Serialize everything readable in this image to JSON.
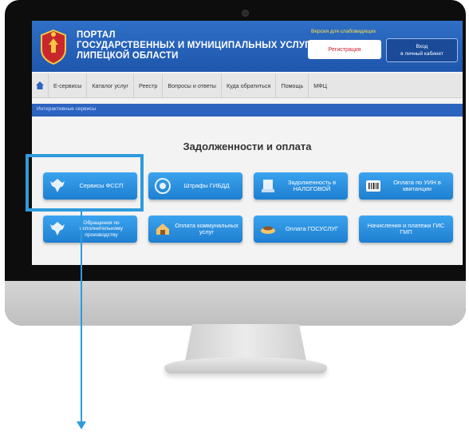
{
  "colors": {
    "header_blue": "#2f6fc6",
    "subbar_blue": "#2c64c0",
    "button_blue": "#3ba3ef",
    "highlight": "#2e9bdd",
    "register_text": "#d0202a",
    "visually_impaired_text": "#f8e04e"
  },
  "header": {
    "title_lines": [
      "ПОРТАЛ",
      "ГОСУДАРСТВЕННЫХ И МУНИЦИПАЛЬНЫХ УСЛУГ",
      "ЛИПЕЦКОЙ ОБЛАСТИ"
    ],
    "visually_impaired": "Версия для слабовидящих",
    "register_label": "Регистрация",
    "login_label_1": "Вход",
    "login_label_2": "в личный кабинет",
    "emblem_icon": "lipetsk-coat-of-arms-icon"
  },
  "nav": {
    "home_icon": "home-icon",
    "items": [
      "Е-сервисы",
      "Каталог услуг",
      "Реестр",
      "Вопросы и ответы",
      "Куда обратиться",
      "Помощь",
      "МФЦ"
    ]
  },
  "subbar": {
    "label": "Интерактивные сервисы"
  },
  "section": {
    "title": "Задолженности и оплата"
  },
  "services": [
    {
      "label": "Сервисы ФССП",
      "icon": "fssp-emblem-icon"
    },
    {
      "label": "Штрафы ГИБДД",
      "icon": "gibdd-badge-icon"
    },
    {
      "label": "Задолженность в НАЛОГОВОЙ",
      "icon": "tax-document-icon"
    },
    {
      "label": "Оплата по УИН в квитанции",
      "icon": "barcode-icon"
    },
    {
      "label": "Обращения по исполнительному производству",
      "icon": "fssp-emblem-icon"
    },
    {
      "label": "Оплата коммунальных услуг",
      "icon": "utilities-house-icon"
    },
    {
      "label": "Оплата ГОСУСЛУГ",
      "icon": "gosuslugi-payment-icon"
    },
    {
      "label": "Начисления и платежи ГИС ГМП",
      "icon": ""
    }
  ]
}
